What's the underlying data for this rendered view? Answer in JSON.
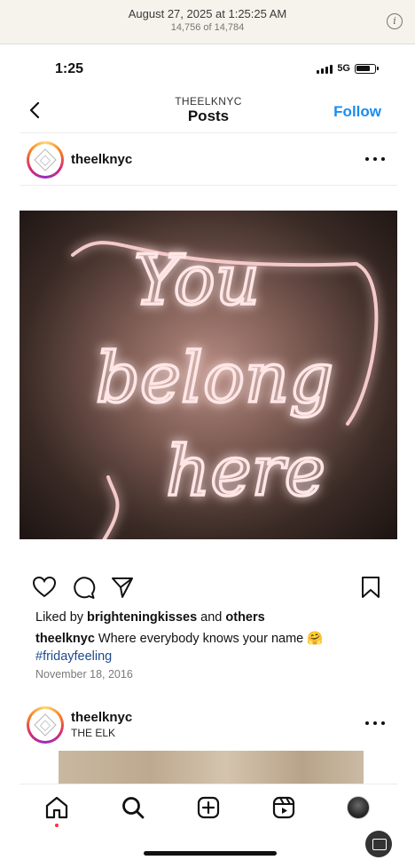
{
  "viewer": {
    "title": "August 27, 2025 at 1:25:25 AM",
    "subtitle": "14,756 of 14,784",
    "info_icon": "info-icon"
  },
  "status_bar": {
    "time": "1:25",
    "network": "5G",
    "signal_icon": "cellular-signal-icon",
    "battery_icon": "battery-icon"
  },
  "nav": {
    "account": "THEELKNYC",
    "title": "Posts",
    "follow_label": "Follow",
    "back_icon": "chevron-left-icon"
  },
  "post": {
    "username": "theelknyc",
    "liked_by_prefix": "Liked by ",
    "liked_by_user": "brighteningkisses",
    "liked_by_middle": " and ",
    "liked_by_others": "others",
    "caption_user": "theelknyc",
    "caption_text": " Where everybody knows your name 🤗",
    "hashtag": "#fridayfeeling",
    "date": "November 18, 2016",
    "image_text": [
      "You",
      "belong",
      "here"
    ],
    "actions": [
      "heart-icon",
      "comment-icon",
      "share-icon",
      "bookmark-icon"
    ]
  },
  "next_post": {
    "username": "theelknyc",
    "location": "THE ELK"
  },
  "tabbar": {
    "tabs": [
      "home-icon",
      "search-icon",
      "create-icon",
      "reels-icon",
      "profile-avatar"
    ]
  },
  "colors": {
    "follow": "#1a8cf0",
    "hashtag": "#1d4a8c",
    "neon": "#ffe3e3",
    "notification_dot": "#ff3040"
  }
}
